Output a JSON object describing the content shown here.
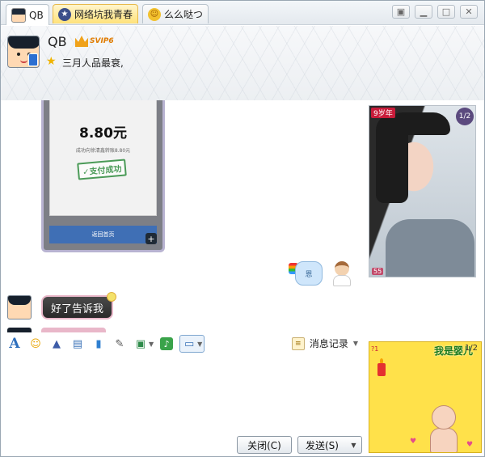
{
  "tabs": [
    {
      "label": "QB",
      "active": true
    },
    {
      "label": "网络坑我青春",
      "highlight": true
    },
    {
      "label": "么么哒つ"
    }
  ],
  "window_controls": [
    "restore-icon",
    "minimize-icon",
    "maximize-icon",
    "close-icon"
  ],
  "header": {
    "nickname": "QB",
    "vip_label": "SVIP6",
    "signature": "三月人品最衰,"
  },
  "toolbar_top": [
    "video-call-icon",
    "voice-call-icon",
    "file-transfer-icon",
    "add-member-icon",
    "remote-assist-icon",
    "screen-share-icon",
    "apps-icon"
  ],
  "chat": {
    "screenshot": {
      "amount": "8.80元",
      "description": "成功向徐清鑫转账8.80元",
      "stamp": "✓支付成功",
      "back_button": "返回首页"
    },
    "message_text": "好了告诉我",
    "sticker_text": "恩"
  },
  "right_top": {
    "tag": "9岁年",
    "page": "1/2",
    "badge": "55"
  },
  "right_bottom": {
    "title": "我是婴儿",
    "tag": "?1",
    "page": "1/2"
  },
  "toolbar_bottom": [
    "font-icon",
    "emoji-icon",
    "magic-icon",
    "video-icon",
    "mic-icon",
    "edit-icon",
    "image-icon",
    "music-icon",
    "screenshot-icon"
  ],
  "history_label": "消息记录",
  "buttons": {
    "close": "关闭(C)",
    "send": "发送(S)"
  }
}
